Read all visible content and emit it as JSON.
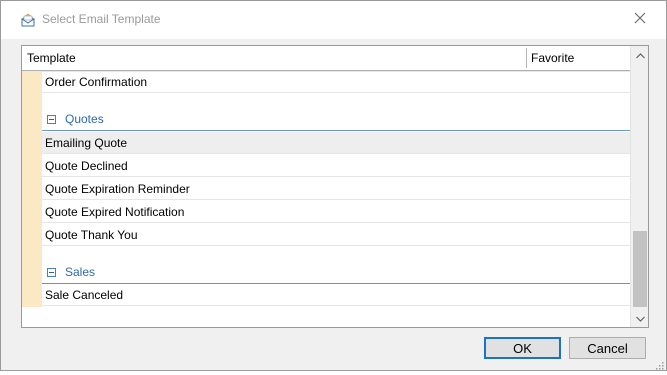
{
  "dialog": {
    "title": "Select Email Template"
  },
  "grid": {
    "columns": {
      "template": "Template",
      "favorite": "Favorite"
    },
    "rows": [
      {
        "type": "item",
        "label": "Order Confirmation"
      },
      {
        "type": "group",
        "label": "Quotes"
      },
      {
        "type": "item",
        "label": "Emailing Quote"
      },
      {
        "type": "item",
        "label": "Quote Declined"
      },
      {
        "type": "item",
        "label": "Quote Expiration Reminder"
      },
      {
        "type": "item",
        "label": "Quote Expired Notification"
      },
      {
        "type": "item",
        "label": "Quote Thank You"
      },
      {
        "type": "group",
        "label": "Sales"
      },
      {
        "type": "item",
        "label": "Sale Canceled"
      }
    ]
  },
  "buttons": {
    "ok": "OK",
    "cancel": "Cancel"
  },
  "colors": {
    "accent": "#1a73c8",
    "group_text": "#2f6aac",
    "indent_strip": "#fbe8c4"
  },
  "icons": {
    "title": "email-template-icon",
    "close": "close-icon",
    "scroll_up": "chevron-up-icon",
    "scroll_down": "chevron-down-icon",
    "collapse": "collapse-minus-icon",
    "resize": "resize-grip-icon"
  }
}
